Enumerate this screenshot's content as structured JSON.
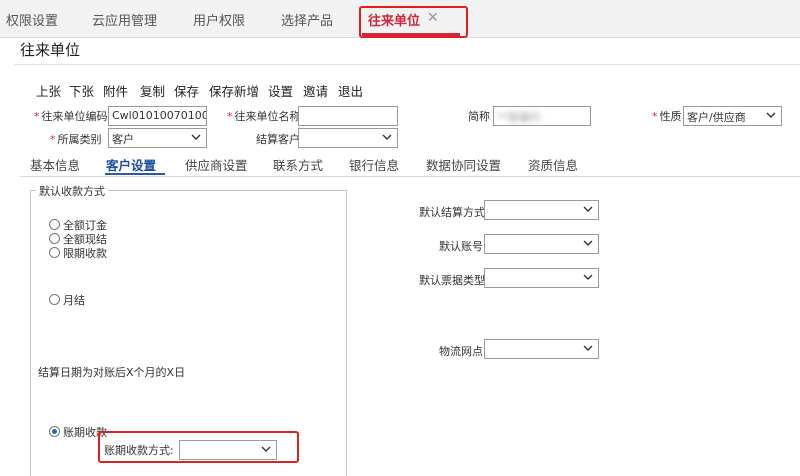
{
  "tabs": [
    {
      "label": "权限设置"
    },
    {
      "label": "云应用管理"
    },
    {
      "label": "用户权限"
    },
    {
      "label": "选择产品"
    },
    {
      "label": "往来单位",
      "active": true
    }
  ],
  "window_title": "往来单位",
  "toolbar": [
    "上张",
    "下张",
    "附件",
    "复制",
    "保存",
    "保存新增",
    "设置",
    "邀请",
    "退出"
  ],
  "form": {
    "code_label": "往来单位编码",
    "code_value": "Cwl01010070100...",
    "name_label": "往来单位名称",
    "name_value": "",
    "abbr_label": "简称",
    "abbr_value": "**安装行",
    "nature_label": "性质",
    "nature_value": "客户/供应商",
    "category_label": "所属类别",
    "category_value": "客户",
    "settle_customer_label": "结算客户",
    "settle_customer_value": ""
  },
  "sub_tabs": [
    "基本信息",
    "客户设置",
    "供应商设置",
    "联系方式",
    "银行信息",
    "数据协同设置",
    "资质信息"
  ],
  "active_sub_tab": "客户设置",
  "receipt": {
    "legend": "默认收款方式",
    "options": [
      "全额订金",
      "全额现结",
      "限期收款",
      "月结"
    ],
    "settle_note": "结算日期为对账后X个月的X日",
    "credit_label": "账期收款",
    "credit_method_label": "账期收款方式:",
    "credit_method_value": ""
  },
  "right_fields": [
    {
      "label": "默认结算方式",
      "value": ""
    },
    {
      "label": "默认账号",
      "value": ""
    },
    {
      "label": "默认票据类型",
      "value": ""
    },
    {
      "label": "物流网点",
      "value": ""
    }
  ],
  "colors": {
    "accent_red": "#d1293b",
    "tab_blue": "#1d4fa0",
    "highlight": "#e01f1f"
  }
}
